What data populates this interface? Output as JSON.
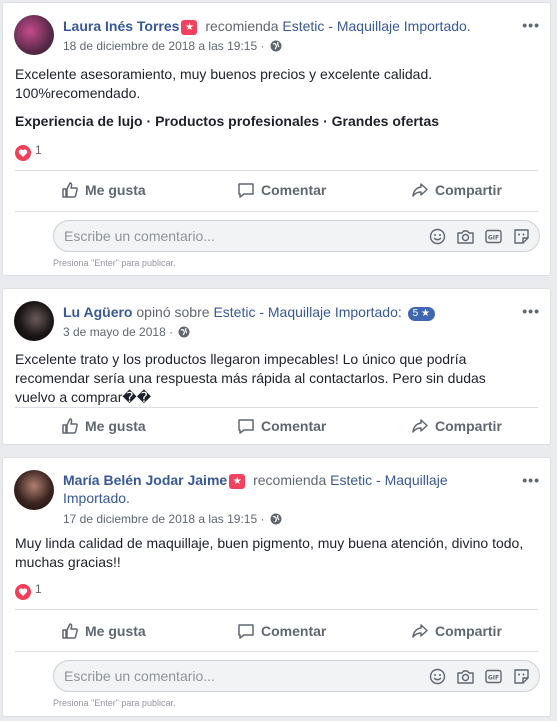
{
  "posts": [
    {
      "author": "Laura Inés Torres",
      "action": "recomienda",
      "page": "Estetic - Maquillaje Importado.",
      "date": "18 de diciembre de 2018 a las 19:15",
      "text": "Excelente asesoramiento, muy buenos precios y excelente calidad. 100%recomendado.",
      "tags": [
        "Experiencia de lujo",
        "Productos profesionales",
        "Grandes ofertas"
      ],
      "reactions": "1"
    },
    {
      "author": "Lu Agüero",
      "action": "opinó sobre",
      "page": "Estetic - Maquillaje Importado:",
      "rating": "5 ★",
      "date": "3 de mayo de 2018",
      "text": "Excelente trato y los productos llegaron impecables! Lo único que podría recomendar sería una respuesta más rápida al contactarlos. Pero sin dudas vuelvo a comprar��"
    },
    {
      "author": "María Belén Jodar Jaime",
      "action": "recomienda",
      "page": "Estetic - Maquillaje Importado.",
      "date": "17 de diciembre de 2018 a las 19:15",
      "text": "Muy linda calidad de maquillaje, buen pigmento, muy buena atención, divino todo, muchas gracias!!",
      "reactions": "1"
    }
  ],
  "actions": {
    "like": "Me gusta",
    "comment": "Comentar",
    "share": "Compartir"
  },
  "comment_box": {
    "placeholder": "Escribe un comentario...",
    "hint": "Presiona \"Enter\" para publicar."
  },
  "colors": {
    "link": "#385898",
    "heart": "#f33e58",
    "badge": "#f3425f",
    "background": "#e9ebee"
  }
}
